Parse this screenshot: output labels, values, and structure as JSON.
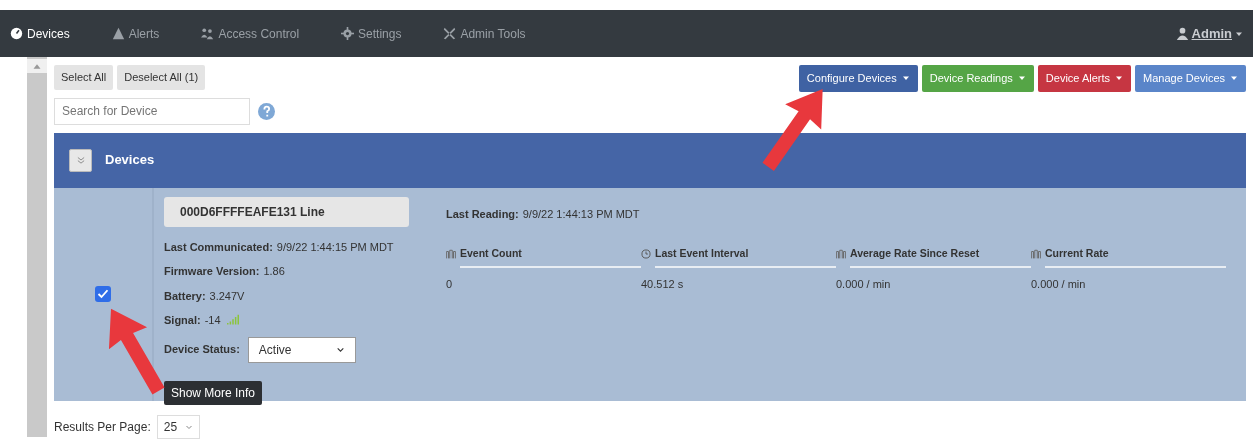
{
  "navbar": {
    "items": [
      {
        "label": "Devices",
        "selected": true
      },
      {
        "label": "Alerts",
        "selected": false
      },
      {
        "label": "Access Control",
        "selected": false
      },
      {
        "label": "Settings",
        "selected": false
      },
      {
        "label": "Admin Tools",
        "selected": false
      }
    ],
    "user": "Admin"
  },
  "toolbar": {
    "select_buttons": [
      "Select All",
      "Deselect All (1)"
    ],
    "search": {
      "placeholder": "Search for Device"
    },
    "menus": [
      {
        "label": "Configure Devices",
        "color": "#3f62a3"
      },
      {
        "label": "Device Readings",
        "color": "#55a546"
      },
      {
        "label": "Device Alerts",
        "color": "#c63642"
      },
      {
        "label": "Manage Devices",
        "color": "#5a85c9"
      }
    ]
  },
  "panel": {
    "title": "Devices",
    "device": {
      "checked": true,
      "name": "000D6FFFFEAFE131 Line",
      "fields": [
        {
          "label": "Last Communicated:",
          "value": "9/9/22 1:44:15 PM MDT"
        },
        {
          "label": "Firmware Version:",
          "value": "1.86"
        },
        {
          "label": "Battery:",
          "value": "3.247V"
        },
        {
          "label": "Signal:",
          "value": "-14"
        }
      ],
      "status_label": "Device Status:",
      "status": "Active",
      "more_button": "Show More Info",
      "last_reading_label": "Last Reading:",
      "last_reading": "9/9/22 1:44:13 PM MDT",
      "metrics": [
        {
          "kind": "pulse",
          "label": "Event Count",
          "value": "0"
        },
        {
          "kind": "clock",
          "label": "Last Event Interval",
          "value": "40.512 s"
        },
        {
          "kind": "pulse",
          "label": "Average Rate Since Reset",
          "value": "0.000 / min"
        },
        {
          "kind": "pulse",
          "label": "Current Rate",
          "value": "0.000 / min"
        }
      ]
    }
  },
  "pagination": {
    "label": "Results Per Page:",
    "value": "25"
  }
}
